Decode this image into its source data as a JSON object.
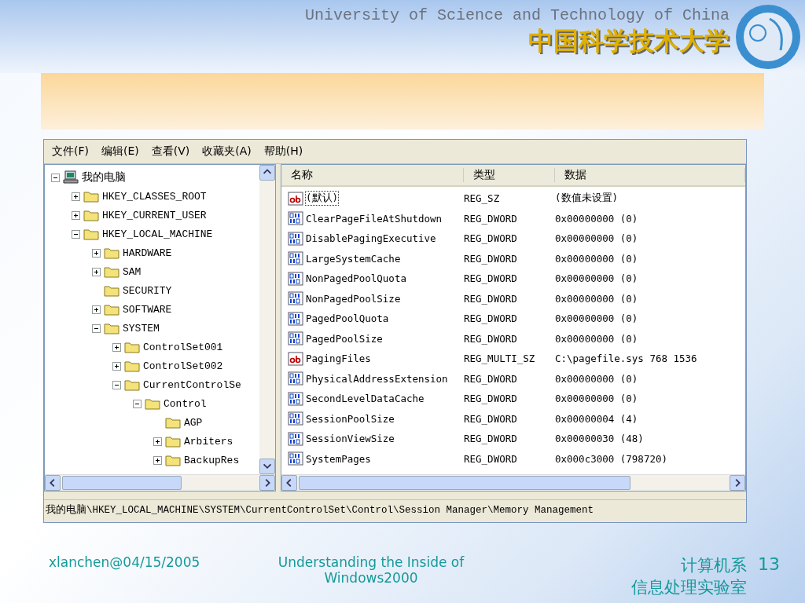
{
  "header": {
    "title_en": "University of Science and Technology of China",
    "title_zh": "中国科学技术大学"
  },
  "window": {
    "menu": [
      {
        "label": "文件(F)"
      },
      {
        "label": "编辑(E)"
      },
      {
        "label": "查看(V)"
      },
      {
        "label": "收藏夹(A)"
      },
      {
        "label": "帮助(H)"
      }
    ],
    "tree": [
      {
        "label": "我的电脑",
        "kind": "computer",
        "expanded": true,
        "children": [
          {
            "label": "HKEY_CLASSES_ROOT",
            "kind": "branch",
            "expanded": false
          },
          {
            "label": "HKEY_CURRENT_USER",
            "kind": "branch",
            "expanded": false
          },
          {
            "label": "HKEY_LOCAL_MACHINE",
            "kind": "branch",
            "expanded": true,
            "children": [
              {
                "label": "HARDWARE",
                "kind": "branch",
                "expanded": false
              },
              {
                "label": "SAM",
                "kind": "branch",
                "expanded": false
              },
              {
                "label": "SECURITY",
                "kind": "leaf"
              },
              {
                "label": "SOFTWARE",
                "kind": "branch",
                "expanded": false
              },
              {
                "label": "SYSTEM",
                "kind": "branch",
                "expanded": true,
                "children": [
                  {
                    "label": "ControlSet001",
                    "kind": "branch",
                    "expanded": false
                  },
                  {
                    "label": "ControlSet002",
                    "kind": "branch",
                    "expanded": false
                  },
                  {
                    "label": "CurrentControlSe",
                    "kind": "branch",
                    "expanded": true,
                    "children": [
                      {
                        "label": "Control",
                        "kind": "branch",
                        "expanded": true,
                        "children": [
                          {
                            "label": "AGP",
                            "kind": "leaf"
                          },
                          {
                            "label": "Arbiters",
                            "kind": "branch",
                            "expanded": false
                          },
                          {
                            "label": "BackupRes",
                            "kind": "branch",
                            "expanded": false
                          }
                        ]
                      }
                    ]
                  }
                ]
              }
            ]
          }
        ]
      }
    ],
    "columns": [
      "名称",
      "类型",
      "数据"
    ],
    "values": [
      {
        "name": "(默认)",
        "type": "REG_SZ",
        "data": "(数值未设置)",
        "kind": "string",
        "selected": true
      },
      {
        "name": "ClearPageFileAtShutdown",
        "type": "REG_DWORD",
        "data": "0x00000000 (0)",
        "kind": "binary",
        "selected": false
      },
      {
        "name": "DisablePagingExecutive",
        "type": "REG_DWORD",
        "data": "0x00000000 (0)",
        "kind": "binary",
        "selected": false
      },
      {
        "name": "LargeSystemCache",
        "type": "REG_DWORD",
        "data": "0x00000000 (0)",
        "kind": "binary",
        "selected": false
      },
      {
        "name": "NonPagedPoolQuota",
        "type": "REG_DWORD",
        "data": "0x00000000 (0)",
        "kind": "binary",
        "selected": false
      },
      {
        "name": "NonPagedPoolSize",
        "type": "REG_DWORD",
        "data": "0x00000000 (0)",
        "kind": "binary",
        "selected": false
      },
      {
        "name": "PagedPoolQuota",
        "type": "REG_DWORD",
        "data": "0x00000000 (0)",
        "kind": "binary",
        "selected": false
      },
      {
        "name": "PagedPoolSize",
        "type": "REG_DWORD",
        "data": "0x00000000 (0)",
        "kind": "binary",
        "selected": false
      },
      {
        "name": "PagingFiles",
        "type": "REG_MULTI_SZ",
        "data": "C:\\pagefile.sys 768 1536",
        "kind": "string",
        "selected": false
      },
      {
        "name": "PhysicalAddressExtension",
        "type": "REG_DWORD",
        "data": "0x00000000 (0)",
        "kind": "binary",
        "selected": false
      },
      {
        "name": "SecondLevelDataCache",
        "type": "REG_DWORD",
        "data": "0x00000000 (0)",
        "kind": "binary",
        "selected": false
      },
      {
        "name": "SessionPoolSize",
        "type": "REG_DWORD",
        "data": "0x00000004 (4)",
        "kind": "binary",
        "selected": false
      },
      {
        "name": "SessionViewSize",
        "type": "REG_DWORD",
        "data": "0x00000030 (48)",
        "kind": "binary",
        "selected": false
      },
      {
        "name": "SystemPages",
        "type": "REG_DWORD",
        "data": "0x000c3000 (798720)",
        "kind": "binary",
        "selected": false
      }
    ],
    "status_bar": "我的电脑\\HKEY_LOCAL_MACHINE\\SYSTEM\\CurrentControlSet\\Control\\Session Manager\\Memory Management"
  },
  "footer": {
    "author": "xlanchen@04/15/2005",
    "title": "Understanding the Inside of Windows2000",
    "department": "计算机系",
    "lab": "信息处理实验室",
    "page": "13"
  }
}
